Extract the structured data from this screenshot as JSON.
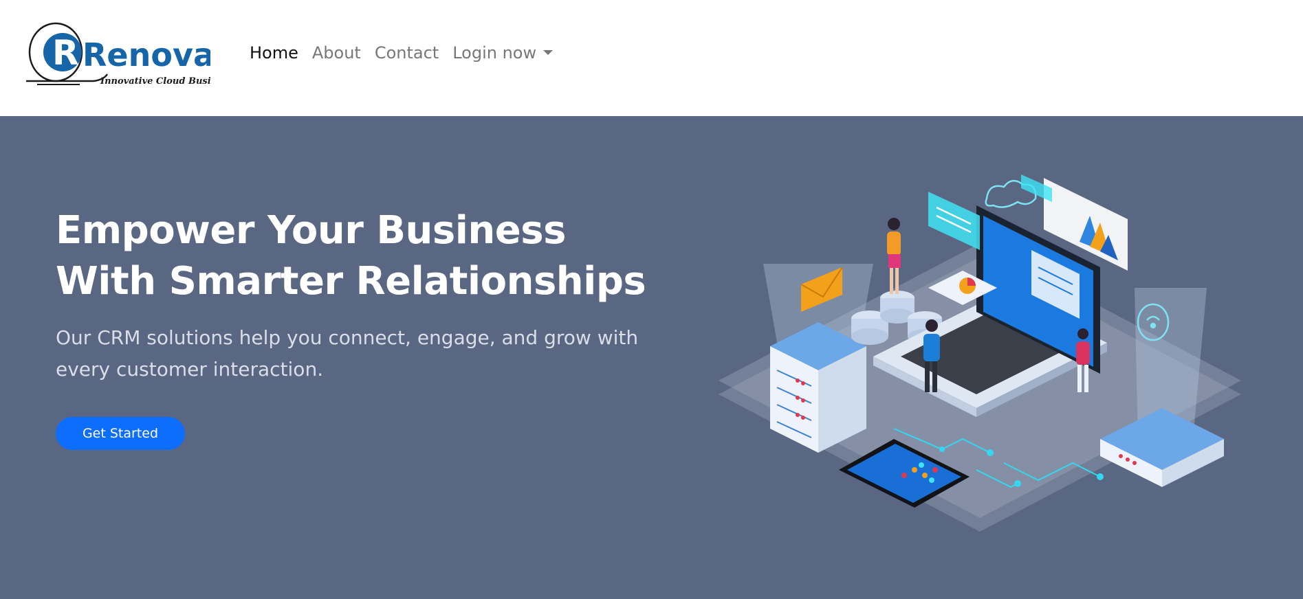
{
  "brand": {
    "name": "Renova",
    "tagline": "Innovative Cloud Business",
    "color": "#1565a8"
  },
  "nav": {
    "items": [
      {
        "label": "Home",
        "active": true
      },
      {
        "label": "About",
        "active": false
      },
      {
        "label": "Contact",
        "active": false
      },
      {
        "label": "Login now",
        "active": false,
        "dropdown": true
      }
    ]
  },
  "hero": {
    "title_line1": "Empower Your Business",
    "title_line2": "With Smarter Relationships",
    "subtitle": "Our CRM solutions help you connect, engage, and grow with every customer interaction.",
    "cta_label": "Get Started",
    "background": "#5a6782",
    "accent": "#0d6efd"
  },
  "illustration": {
    "name": "isometric-cloud-crm-illustration"
  }
}
